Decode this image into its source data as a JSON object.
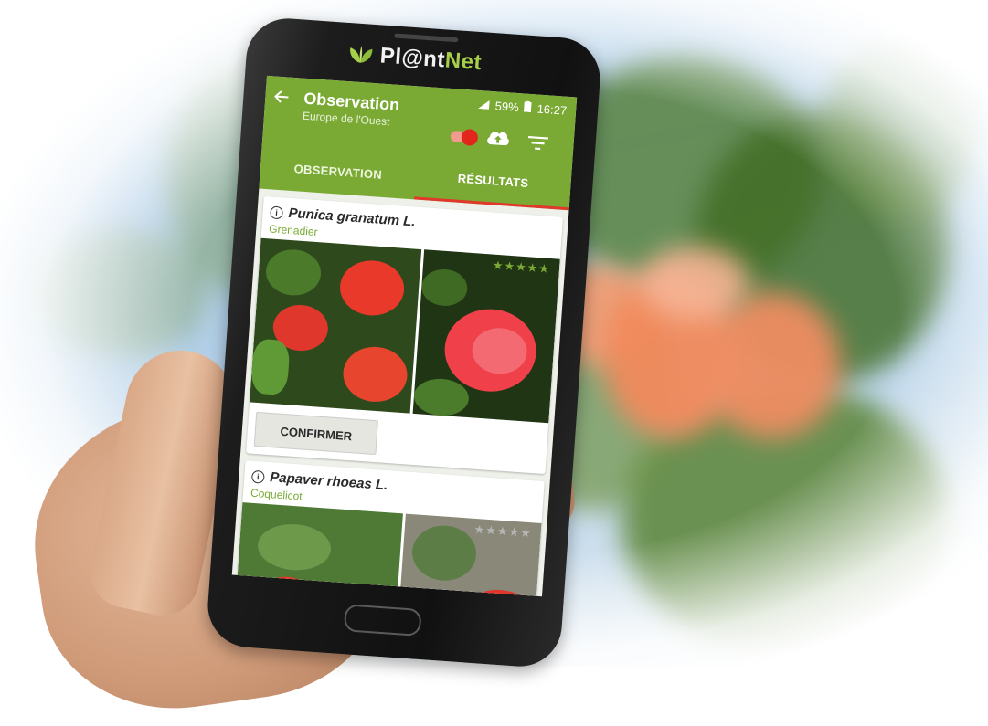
{
  "app": {
    "brand_prefix": "Pl@nt",
    "brand_suffix": "Net"
  },
  "status_bar": {
    "battery": "59%",
    "time": "16:27"
  },
  "header": {
    "title": "Observation",
    "subtitle": "Europe de l'Ouest"
  },
  "tabs": [
    {
      "label": "OBSERVATION",
      "active": false
    },
    {
      "label": "RÉSULTATS",
      "active": true
    }
  ],
  "results": [
    {
      "species": "Punica granatum L.",
      "common_name": "Grenadier",
      "rating": 5,
      "max_rating": 5,
      "stars_text": "★★★★★",
      "confirm_label": "CONFIRMER"
    },
    {
      "species": "Papaver rhoeas L.",
      "common_name": "Coquelicot",
      "rating": 0,
      "max_rating": 5,
      "stars_text": "★★★★★"
    }
  ],
  "colors": {
    "brand_green": "#7aaa34",
    "tab_indicator": "#e0382a",
    "rating_active": "#7aaa34",
    "rating_inactive": "#b5b5b5"
  },
  "icons": [
    "back-arrow-icon",
    "toggle-icon",
    "cloud-upload-icon",
    "filter-icon",
    "info-icon",
    "star-icon",
    "leaf-logo-icon"
  ]
}
